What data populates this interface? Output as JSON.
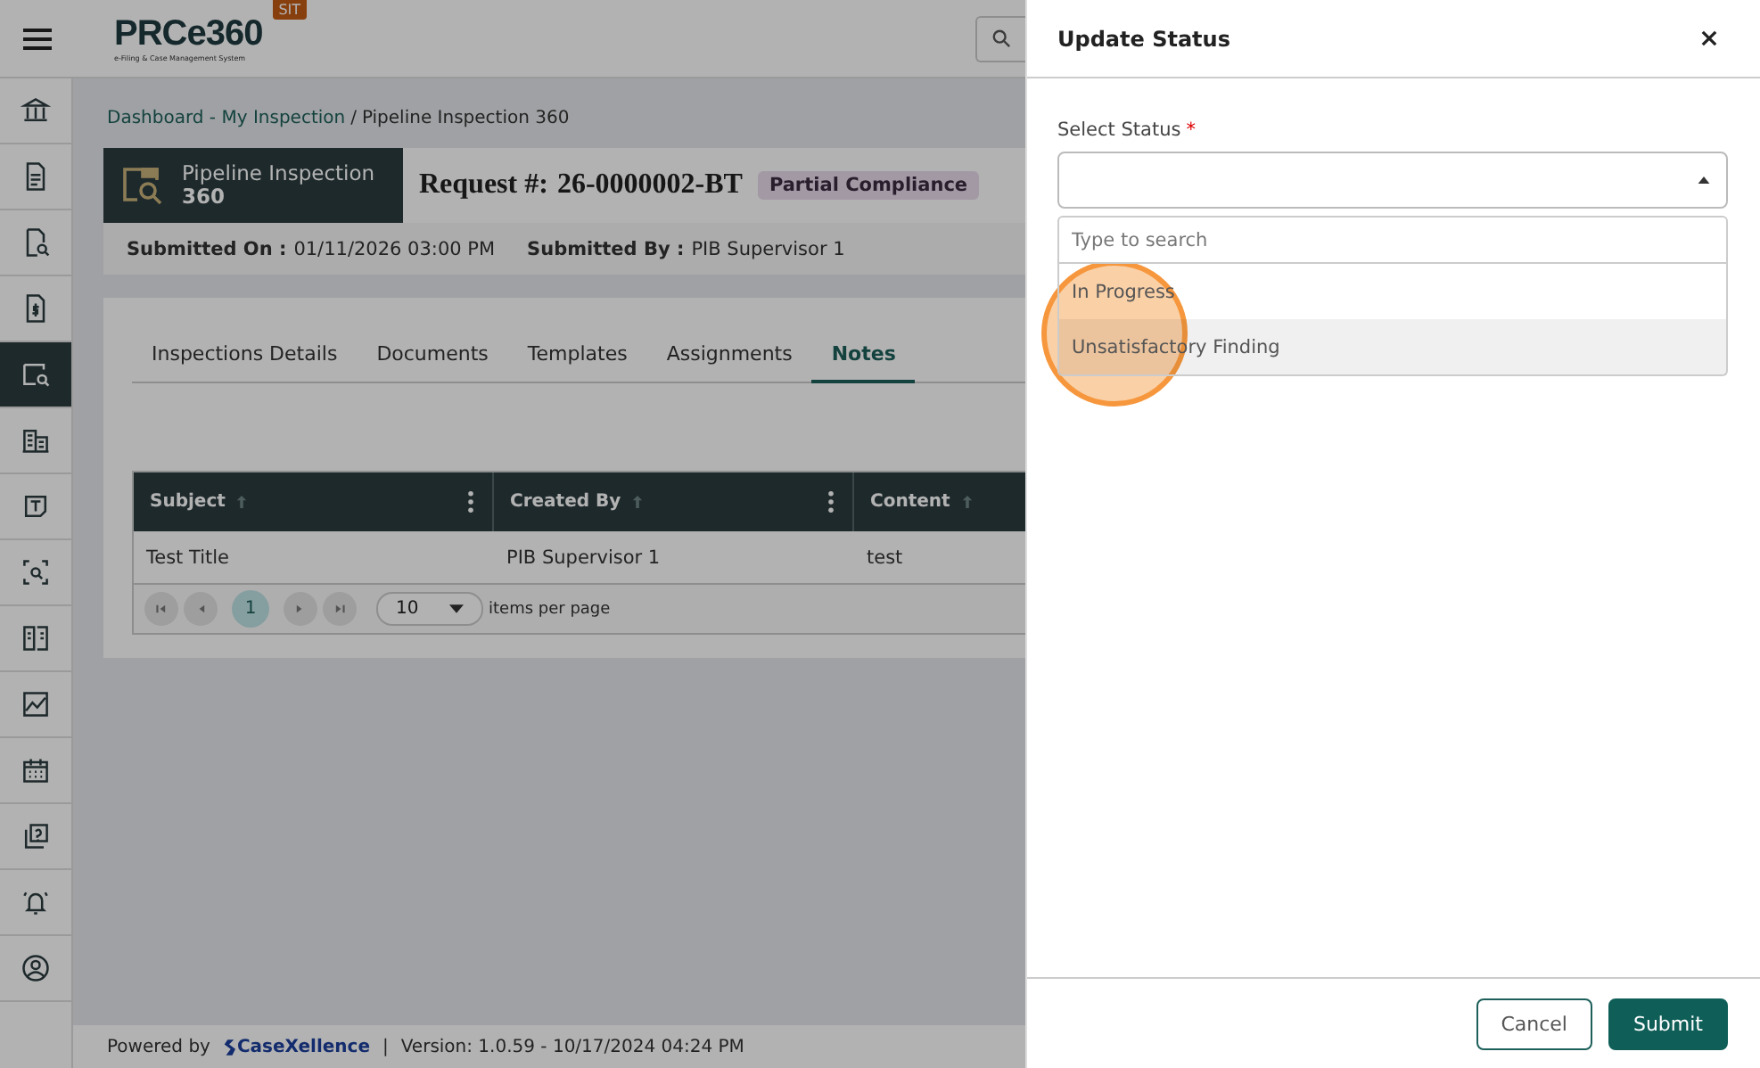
{
  "app": {
    "logo": "PRCe360",
    "tagline": "e-Filing & Case Management System",
    "env_badge": "SIT"
  },
  "sidebar": {
    "items": [
      {
        "selected": false
      },
      {
        "selected": false
      },
      {
        "selected": false
      },
      {
        "selected": false
      },
      {
        "selected": true
      },
      {
        "selected": false
      },
      {
        "selected": false
      },
      {
        "selected": false
      },
      {
        "selected": false
      },
      {
        "selected": false
      },
      {
        "selected": false
      },
      {
        "selected": false
      },
      {
        "selected": false
      },
      {
        "selected": false
      }
    ]
  },
  "breadcrumb": {
    "link": "Dashboard - My Inspection",
    "separator": "/",
    "current": "Pipeline Inspection 360"
  },
  "request": {
    "module": "Pipeline Inspection",
    "module_sub": "360",
    "label": "Request #:",
    "number": "26-0000002-BT",
    "status": "Partial Compliance",
    "submitted_on_label": "Submitted On :",
    "submitted_on": "01/11/2026 03:00 PM",
    "submitted_by_label": "Submitted By :",
    "submitted_by": "PIB Supervisor 1"
  },
  "tabs": [
    {
      "label": "Inspections Details",
      "selected": false
    },
    {
      "label": "Documents",
      "selected": false
    },
    {
      "label": "Templates",
      "selected": false
    },
    {
      "label": "Assignments",
      "selected": false
    },
    {
      "label": "Notes",
      "selected": true
    }
  ],
  "table": {
    "columns": [
      "Subject",
      "Created By",
      "Content"
    ],
    "rows": [
      [
        "Test Title",
        "PIB Supervisor 1",
        "test"
      ]
    ]
  },
  "pager": {
    "current_page": "1",
    "page_size": "10",
    "page_size_label": "items per page"
  },
  "footer": {
    "powered_by": "Powered by",
    "brand": "CaseXellence",
    "separator": "|",
    "version": "Version: 1.0.59 - 10/17/2024 04:24 PM"
  },
  "drawer": {
    "title": "Update Status",
    "field_label": "Select Status",
    "required_mark": "*",
    "search_placeholder": "Type to search",
    "options": [
      {
        "label": "In Progress",
        "selected": false
      },
      {
        "label": "Unsatisfactory Finding",
        "selected": true
      }
    ],
    "buttons": [
      {
        "label": "Cancel",
        "kind": "secondary"
      },
      {
        "label": "Submit",
        "kind": "primary"
      }
    ]
  }
}
